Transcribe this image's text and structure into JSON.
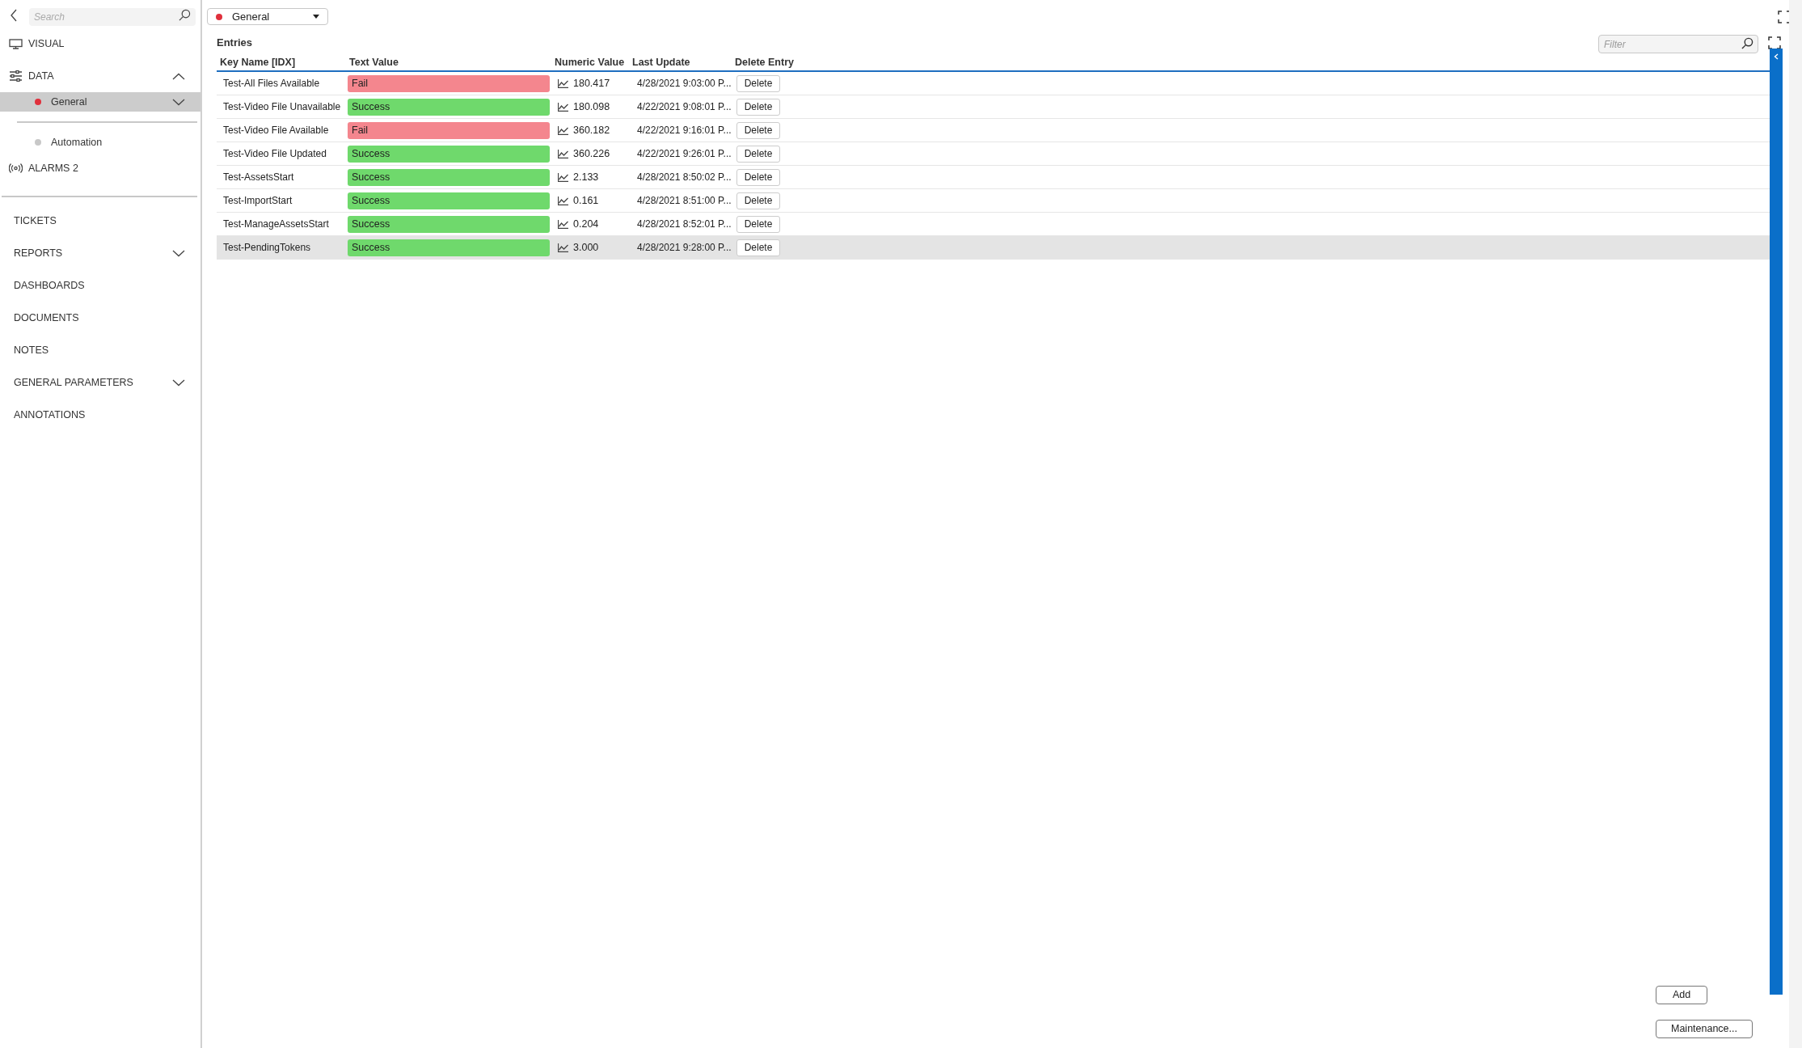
{
  "sidebar": {
    "search": {
      "placeholder": "Search"
    },
    "sections": [
      {
        "kind": "visual",
        "label": "VISUAL"
      },
      {
        "kind": "data",
        "label": "DATA",
        "expanded": true,
        "children": [
          {
            "label": "General",
            "color": "#e0303c",
            "selected": true,
            "expanded": false
          },
          {
            "label": "Automation",
            "color": "#c8c8c8",
            "selected": false
          }
        ]
      },
      {
        "kind": "alarms",
        "label": "ALARMS 2"
      }
    ],
    "nav": [
      {
        "label": "TICKETS"
      },
      {
        "label": "REPORTS",
        "expanded": false
      },
      {
        "label": "DASHBOARDS"
      },
      {
        "label": "DOCUMENTS"
      },
      {
        "label": "NOTES"
      },
      {
        "label": "GENERAL PARAMETERS",
        "expanded": false
      },
      {
        "label": "ANNOTATIONS"
      }
    ]
  },
  "selector": {
    "value": "General",
    "color": "#e0303c"
  },
  "entries": {
    "title": "Entries",
    "filter": {
      "placeholder": "Filter"
    },
    "columns": [
      "Key Name [IDX]",
      "Text Value",
      "Numeric Value",
      "Last Update",
      "Delete Entry"
    ],
    "rows": [
      {
        "key": "Test-All Files Available",
        "text": "Fail",
        "color": "#f4868e",
        "numeric": "180.417",
        "updated": "4/28/2021 9:03:00 P...",
        "action": "Delete",
        "selected": false
      },
      {
        "key": "Test-Video File Unavailable",
        "text": "Success",
        "color": "#6fd96c",
        "numeric": "180.098",
        "updated": "4/22/2021 9:08:01 P...",
        "action": "Delete",
        "selected": false
      },
      {
        "key": "Test-Video File Available",
        "text": "Fail",
        "color": "#f4868e",
        "numeric": "360.182",
        "updated": "4/22/2021 9:16:01 P...",
        "action": "Delete",
        "selected": false
      },
      {
        "key": "Test-Video File Updated",
        "text": "Success",
        "color": "#6fd96c",
        "numeric": "360.226",
        "updated": "4/22/2021 9:26:01 P...",
        "action": "Delete",
        "selected": false
      },
      {
        "key": "Test-AssetsStart",
        "text": "Success",
        "color": "#6fd96c",
        "numeric": "2.133",
        "updated": "4/28/2021 8:50:02 P...",
        "action": "Delete",
        "selected": false
      },
      {
        "key": "Test-ImportStart",
        "text": "Success",
        "color": "#6fd96c",
        "numeric": "0.161",
        "updated": "4/28/2021 8:51:00 P...",
        "action": "Delete",
        "selected": false
      },
      {
        "key": "Test-ManageAssetsStart",
        "text": "Success",
        "color": "#6fd96c",
        "numeric": "0.204",
        "updated": "4/28/2021 8:52:01 P...",
        "action": "Delete",
        "selected": false
      },
      {
        "key": "Test-PendingTokens",
        "text": "Success",
        "color": "#6fd96c",
        "numeric": "3.000",
        "updated": "4/28/2021 9:28:00 P...",
        "action": "Delete",
        "selected": true
      }
    ]
  },
  "buttons": [
    "Add",
    "Maintenance..."
  ]
}
